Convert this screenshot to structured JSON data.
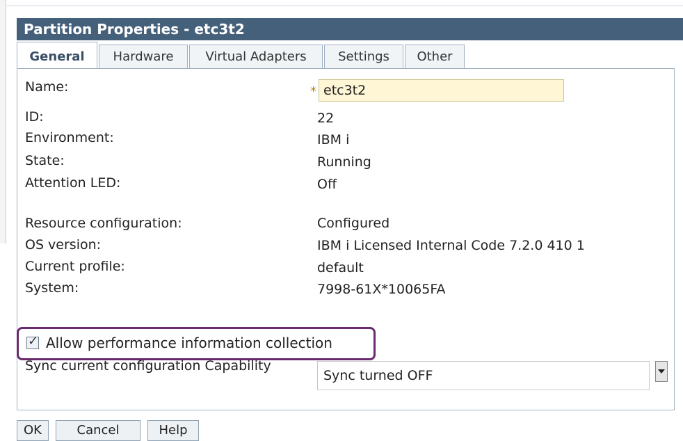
{
  "window": {
    "title": "Partition Properties - etc3t2"
  },
  "tabs": [
    "General",
    "Hardware",
    "Virtual Adapters",
    "Settings",
    "Other"
  ],
  "general": {
    "name_label": "Name:",
    "name_required": "*",
    "name_value": "etc3t2",
    "fields": [
      {
        "label": "ID:",
        "value": "22"
      },
      {
        "label": "Environment:",
        "value": "IBM i"
      },
      {
        "label": "State:",
        "value": "Running"
      },
      {
        "label": "Attention LED:",
        "value": "Off"
      },
      {
        "label": "Resource configuration:",
        "value": "Configured"
      },
      {
        "label": "OS version:",
        "value": "IBM i Licensed Internal Code 7.2.0 410 1"
      },
      {
        "label": "Current profile:",
        "value": "default"
      },
      {
        "label": "System:",
        "value": "7998-61X*10065FA"
      }
    ],
    "perf_checkbox_label": "Allow performance information collection",
    "perf_checked": true,
    "sync_label": "Sync current configuration Capability",
    "sync_value": "Sync turned OFF"
  },
  "buttons": {
    "ok": "OK",
    "cancel": "Cancel",
    "help": "Help"
  },
  "colors": {
    "title_bar": "#45607a",
    "highlight": "#6a2a6e",
    "input_bg": "#fff6d6"
  }
}
